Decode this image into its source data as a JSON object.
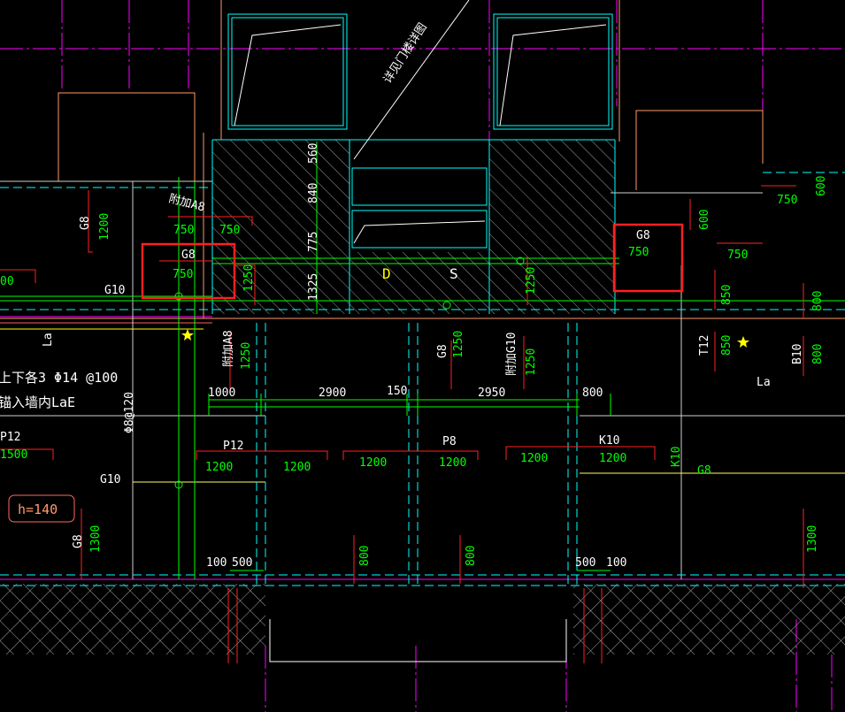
{
  "colors": {
    "background": "#000000",
    "wall_cyan": "#00ffff",
    "rebar_green": "#00ff00",
    "dim_red": "#ff0000",
    "magenta": "#ff00ff",
    "white": "#ffffff",
    "yellow": "#ffff00",
    "highlight": "#ff2020",
    "hatch": "#b0b0b0"
  },
  "stair_note": "详见门楼详图",
  "dimensions": {
    "d560": "560",
    "d840": "840",
    "d775": "775",
    "d1325": "1325",
    "d1000": "1000",
    "d2900": "2900",
    "d150": "150",
    "d2950": "2950",
    "d800": "800",
    "d100_left": "100",
    "d500_left": "500",
    "d500_right": "500",
    "d100_right": "100"
  },
  "left": {
    "g8_top_name": "G8",
    "g8_top_len": "1200",
    "fujia_a8": "附加A8",
    "fujia_a8_len": "750",
    "fujia_a8_len2": "750",
    "g8_box_name": "G8",
    "g8_box_len": "750",
    "g10": "G10",
    "len_00": "00",
    "la": "La",
    "note_line1": "上下各3 Φ14 @100",
    "note_line2": "锚入墙内LaE",
    "phi8": "Φ8@120",
    "p12_left": "P12",
    "p12_left_len": "1500",
    "g10_lower": "G10",
    "h140": "h=140",
    "g8_low_name": "G8",
    "g8_low_len": "1300",
    "len_1250_a": "1250",
    "fujia_a8_b": "附加A8",
    "fujia_a8_b_len": "1250"
  },
  "center": {
    "d_label": "D",
    "s_label": "S",
    "len_1250_mid": "1250",
    "g8_mid_name": "G8",
    "g8_mid_len": "1250",
    "fujia_g10": "附加G10",
    "fujia_g10_len": "1250",
    "p12_name": "P12",
    "p12_len_a": "1200",
    "p12_len_b": "1200",
    "p8_name": "P8",
    "p8_len_a": "1200",
    "p8_len_b": "1200",
    "len_800_a": "800",
    "len_800_b": "800"
  },
  "right": {
    "g8_box_name": "G8",
    "g8_box_len": "750",
    "len_600": "600",
    "len_750_a": "750",
    "len_750_b": "750",
    "len_600_b": "600",
    "len_850_a": "850",
    "len_850_b": "850",
    "t12": "T12",
    "len_800": "800",
    "b10": "B10",
    "len_800_b": "800",
    "la": "La",
    "k10_name": "K10",
    "k10_len_a": "1200",
    "k10_len_b": "1200",
    "k10_vert": "K10",
    "g8_right": "G8",
    "len_1300": "1300"
  }
}
